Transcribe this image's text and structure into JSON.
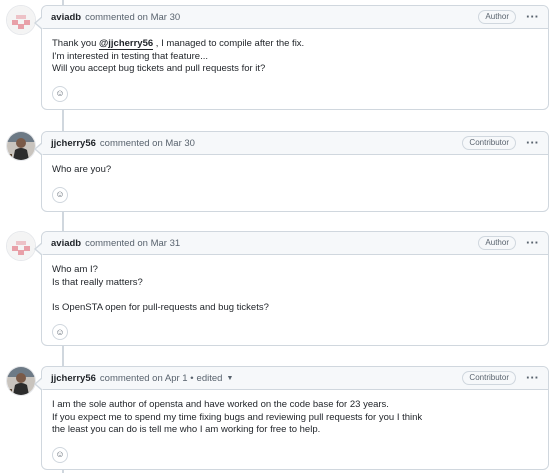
{
  "comments": [
    {
      "author": "aviadb",
      "meta": "commented on Mar 30",
      "role": "Author",
      "avatar": "identicon-pink",
      "body": {
        "line1_pre": "Thank you ",
        "mention": "@jjcherry56",
        "line1_post": " , I managed to compile after the fix.",
        "line2": "I'm interested in testing that feature...",
        "line3": "Will you accept bug tickets and pull requests for it?"
      }
    },
    {
      "author": "jjcherry56",
      "meta": "commented on Mar 30",
      "role": "Contributor",
      "avatar": "photo-avatar",
      "body": {
        "line1": "Who are you?"
      }
    },
    {
      "author": "aviadb",
      "meta": "commented on Mar 31",
      "role": "Author",
      "avatar": "identicon-pink",
      "body": {
        "line1": "Who am I?",
        "line2": "Is that really matters?",
        "line3": "Is OpenSTA open for pull-requests and bug tickets?"
      }
    },
    {
      "author": "jjcherry56",
      "meta": "commented on Apr 1 •",
      "edited": "edited",
      "role": "Contributor",
      "avatar": "photo-avatar",
      "body": {
        "line1": "I am the sole author of opensta and have worked on the code base for 23 years.",
        "line2": "If you expect me to spend my time fixing bugs and reviewing pull requests for you I think",
        "line3": "the least you can do is tell me who I am working for free to help."
      }
    }
  ],
  "icons": {
    "reaction": "smiley-icon",
    "menu": "kebab-icon",
    "caret": "triangle-down-icon"
  },
  "colors": {
    "identicon": "#e8a0a8",
    "border": "#d0d7de",
    "header_bg": "#f6f8fa"
  }
}
